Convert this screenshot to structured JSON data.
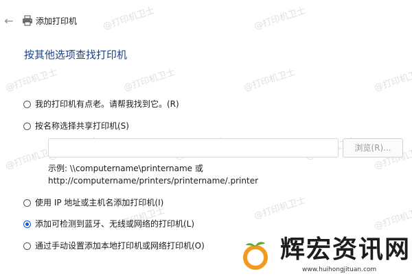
{
  "window": {
    "title": "添加打印机",
    "back_icon": "arrow-left-icon",
    "app_icon": "printer-icon"
  },
  "heading": "按其他选项查找打印机",
  "options": [
    {
      "label": "我的打印机有点老。请帮我找到它。(R)",
      "selected": false
    },
    {
      "label": "按名称选择共享打印机(S)",
      "selected": false
    },
    {
      "label": "使用 IP 地址或主机名添加打印机(I)",
      "selected": false
    },
    {
      "label": "添加可检测到蓝牙、无线或网络的打印机(L)",
      "selected": true
    },
    {
      "label": "通过手动设置添加本地打印机或网络打印机(O)",
      "selected": false
    }
  ],
  "share": {
    "input_value": "",
    "browse_label": "浏览(R)...",
    "example_line1": "示例: \\\\computername\\printername 或",
    "example_line2": "http://computername/printers/printername/.printer"
  },
  "watermark": "@打印机卫士",
  "logo": {
    "text": "辉宏资讯网",
    "url": "www.huihongjituan.com"
  },
  "colors": {
    "heading": "#1d3f8a",
    "accent": "#0a5fc4",
    "logo_orange": "#f29a1f",
    "logo_green": "#5aa832"
  }
}
